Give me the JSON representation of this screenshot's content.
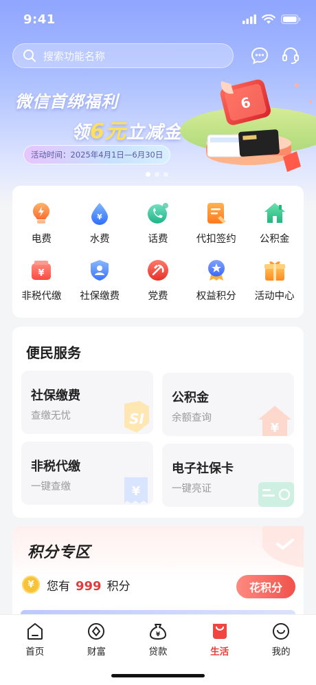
{
  "status_bar": {
    "time": "9:41"
  },
  "search": {
    "placeholder": "搜索功能名称"
  },
  "banner": {
    "title_line1": "微信首绑福利",
    "title_prefix": "领",
    "title_amount": "6元",
    "title_suffix": "立减金",
    "date_text": "活动时间：2025年4月1日—6月30日",
    "card_label": "6",
    "page_count": 3,
    "active_page": 1
  },
  "quick_grid": [
    {
      "label": "电费",
      "icon": "electricity-bulb-icon",
      "color": "#ff8a3d"
    },
    {
      "label": "水费",
      "icon": "water-drop-icon",
      "color": "#3d8bff"
    },
    {
      "label": "话费",
      "icon": "phone-icon",
      "color": "#2fc49a"
    },
    {
      "label": "代扣签约",
      "icon": "document-icon",
      "color": "#ff8a3d"
    },
    {
      "label": "公积金",
      "icon": "house-icon",
      "color": "#34c78f"
    },
    {
      "label": "非税代缴",
      "icon": "yuan-bag-icon",
      "color": "#ff5f55"
    },
    {
      "label": "社保缴费",
      "icon": "shield-user-icon",
      "color": "#3d8bff"
    },
    {
      "label": "党费",
      "icon": "party-emblem-icon",
      "color": "#f24a3d"
    },
    {
      "label": "权益积分",
      "icon": "medal-icon",
      "color": "#4a7bff"
    },
    {
      "label": "活动中心",
      "icon": "gift-box-icon",
      "color": "#ff9b2f"
    }
  ],
  "services": {
    "title": "便民服务",
    "tiles": [
      {
        "title": "社保缴费",
        "sub": "查缴无忧",
        "art_text": "SI"
      },
      {
        "title": "公积金",
        "sub": "余额查询",
        "art_text": "¥"
      },
      {
        "title": "非税代缴",
        "sub": "一键查缴",
        "art_text": "¥"
      },
      {
        "title": "电子社保卡",
        "sub": "一键亮证",
        "art_text": ""
      }
    ]
  },
  "points": {
    "title": "积分专区",
    "prefix": "您有",
    "value": "999",
    "suffix": "积分",
    "button": "花积分",
    "coin_symbol": "¥"
  },
  "tabbar": [
    {
      "label": "首页",
      "icon": "home-icon",
      "active": false
    },
    {
      "label": "财富",
      "icon": "wealth-icon",
      "active": false
    },
    {
      "label": "贷款",
      "icon": "loan-bag-icon",
      "active": false
    },
    {
      "label": "生活",
      "icon": "life-bag-icon",
      "active": true
    },
    {
      "label": "我的",
      "icon": "profile-icon",
      "active": false
    }
  ],
  "colors": {
    "accent_red": "#e8403d",
    "banner_blue": "#8fa5ff"
  }
}
